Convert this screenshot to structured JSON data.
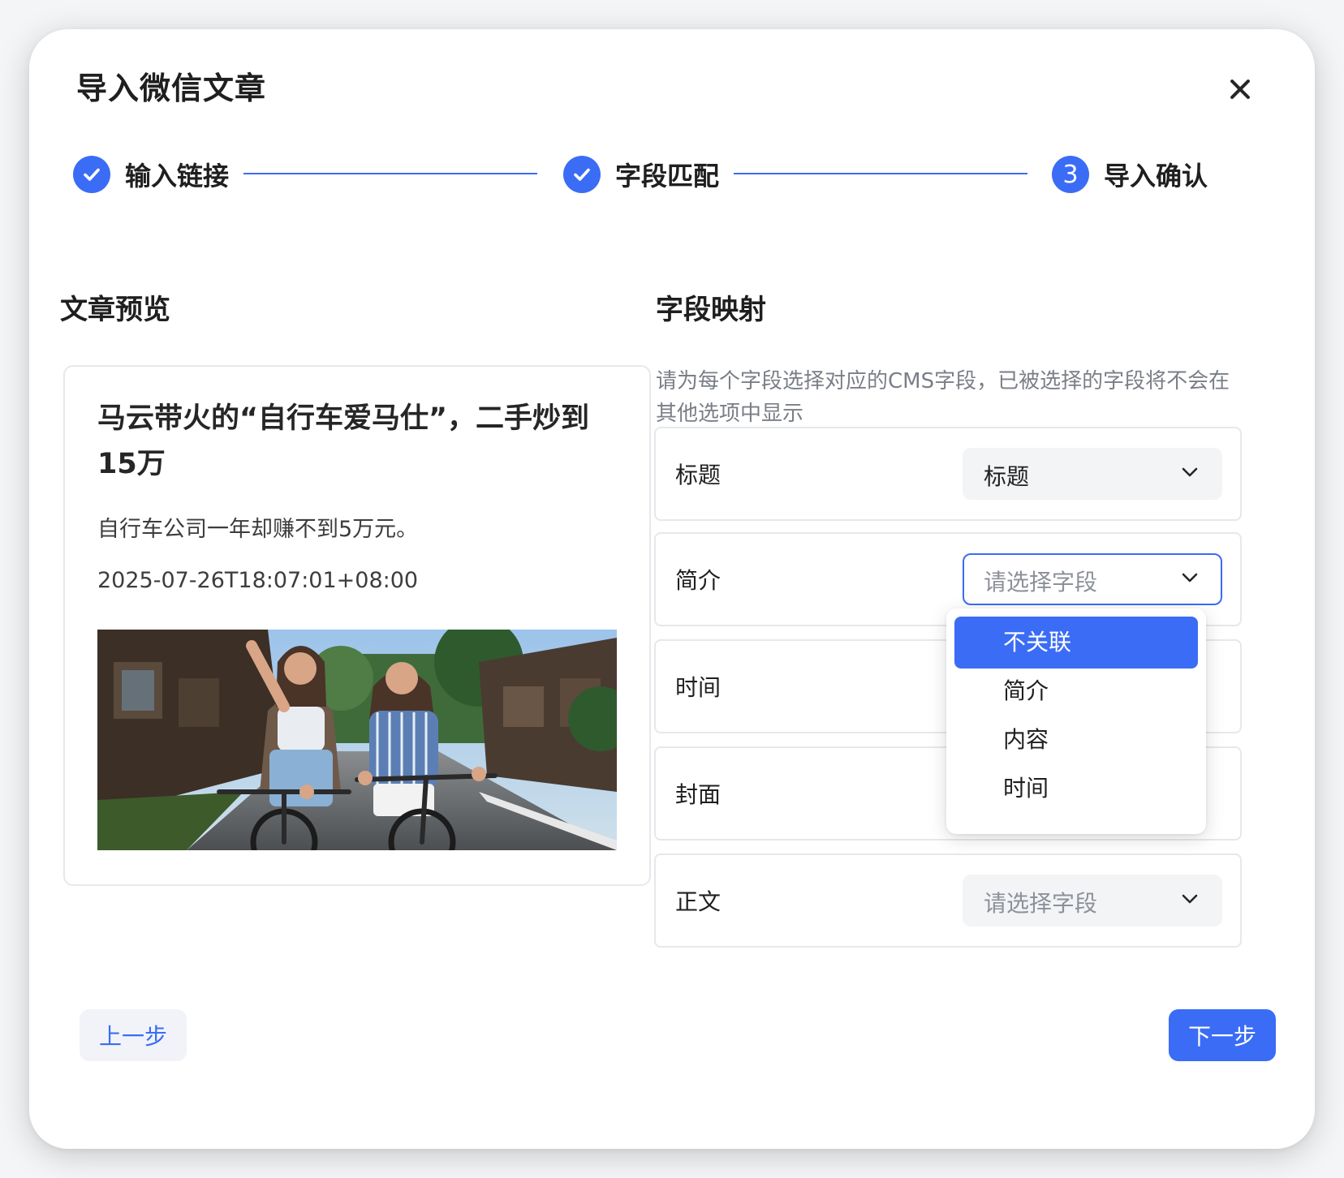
{
  "dialog": {
    "title": "导入微信文章",
    "close_icon": "close-icon"
  },
  "steps": [
    {
      "label": "输入链接",
      "status": "done",
      "icon": "check-icon"
    },
    {
      "label": "字段匹配",
      "status": "done",
      "icon": "check-icon"
    },
    {
      "label": "导入确认",
      "status": "current",
      "number": "3"
    }
  ],
  "preview": {
    "section_title": "文章预览",
    "article_title": "马云带火的“自行车爱马仕”，二手炒到15万",
    "summary": "自行车公司一年却赚不到5万元。",
    "publish_time": "2025-07-26T18:07:01+08:00",
    "cover_icon": "cover-image"
  },
  "mapping": {
    "section_title": "字段映射",
    "description": "请为每个字段选择对应的CMS字段，已被选择的字段将不会在其他选项中显示",
    "fields": [
      {
        "label": "标题",
        "value": "标题",
        "placeholder": "请选择字段"
      },
      {
        "label": "简介",
        "value": "",
        "placeholder": "请选择字段"
      },
      {
        "label": "时间",
        "value": "",
        "placeholder": "请选择字段"
      },
      {
        "label": "封面",
        "value": "",
        "placeholder": "请选择字段"
      },
      {
        "label": "正文",
        "value": "",
        "placeholder": "请选择字段"
      }
    ],
    "dropdown_options": [
      "不关联",
      "简介",
      "内容",
      "时间"
    ],
    "dropdown_active_option": "不关联"
  },
  "footer": {
    "prev_label": "上一步",
    "next_label": "下一步"
  },
  "colors": {
    "primary": "#3b6cf5",
    "border": "#e6e8eb",
    "select_bg": "#f3f4f6",
    "muted_text": "#7a7f87"
  }
}
